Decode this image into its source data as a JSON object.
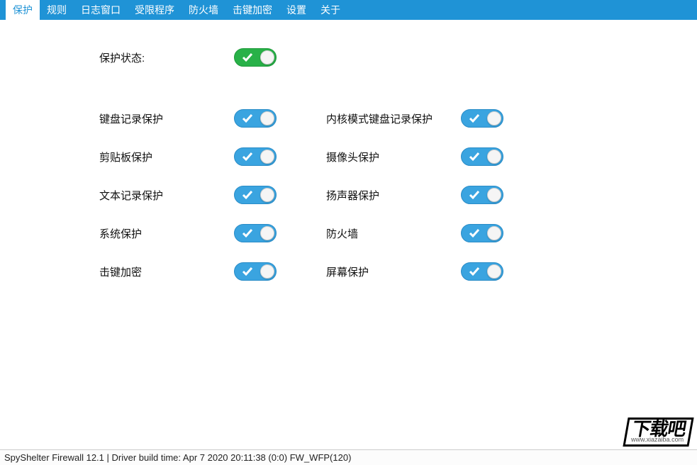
{
  "menu": {
    "items": [
      {
        "label": "保护",
        "active": true
      },
      {
        "label": "规则",
        "active": false
      },
      {
        "label": "日志窗口",
        "active": false
      },
      {
        "label": "受限程序",
        "active": false
      },
      {
        "label": "防火墙",
        "active": false
      },
      {
        "label": "击键加密",
        "active": false
      },
      {
        "label": "设置",
        "active": false
      },
      {
        "label": "关于",
        "active": false
      }
    ]
  },
  "protection": {
    "main_label": "保护状态:",
    "left": [
      {
        "label": "键盘记录保护"
      },
      {
        "label": "剪贴板保护"
      },
      {
        "label": "文本记录保护"
      },
      {
        "label": "系统保护"
      },
      {
        "label": "击键加密"
      }
    ],
    "right": [
      {
        "label": "内核模式键盘记录保护"
      },
      {
        "label": "摄像头保护"
      },
      {
        "label": "扬声器保护"
      },
      {
        "label": "防火墙"
      },
      {
        "label": "屏幕保护"
      }
    ]
  },
  "statusbar": {
    "text": "SpyShelter Firewall 12.1   |   Driver build time: Apr  7 2020 20:11:38  (0:0) FW_WFP(120)"
  },
  "watermark": {
    "text": "下载吧",
    "url": "www.xiazaiba.com"
  }
}
